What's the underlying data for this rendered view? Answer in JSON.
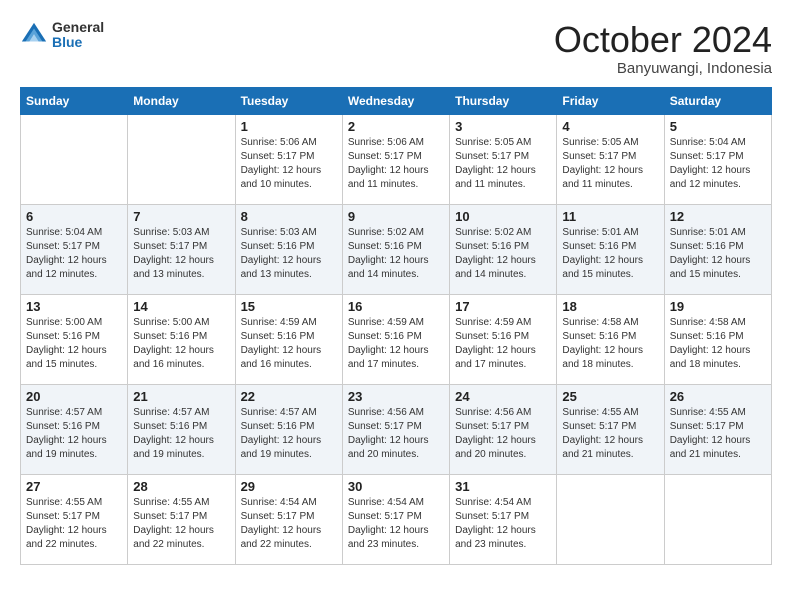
{
  "header": {
    "logo": {
      "general": "General",
      "blue": "Blue"
    },
    "title": "October 2024",
    "location": "Banyuwangi, Indonesia"
  },
  "columns": [
    "Sunday",
    "Monday",
    "Tuesday",
    "Wednesday",
    "Thursday",
    "Friday",
    "Saturday"
  ],
  "weeks": [
    [
      {
        "day": "",
        "sunrise": "",
        "sunset": "",
        "daylight": ""
      },
      {
        "day": "",
        "sunrise": "",
        "sunset": "",
        "daylight": ""
      },
      {
        "day": "1",
        "sunrise": "Sunrise: 5:06 AM",
        "sunset": "Sunset: 5:17 PM",
        "daylight": "Daylight: 12 hours and 10 minutes."
      },
      {
        "day": "2",
        "sunrise": "Sunrise: 5:06 AM",
        "sunset": "Sunset: 5:17 PM",
        "daylight": "Daylight: 12 hours and 11 minutes."
      },
      {
        "day": "3",
        "sunrise": "Sunrise: 5:05 AM",
        "sunset": "Sunset: 5:17 PM",
        "daylight": "Daylight: 12 hours and 11 minutes."
      },
      {
        "day": "4",
        "sunrise": "Sunrise: 5:05 AM",
        "sunset": "Sunset: 5:17 PM",
        "daylight": "Daylight: 12 hours and 11 minutes."
      },
      {
        "day": "5",
        "sunrise": "Sunrise: 5:04 AM",
        "sunset": "Sunset: 5:17 PM",
        "daylight": "Daylight: 12 hours and 12 minutes."
      }
    ],
    [
      {
        "day": "6",
        "sunrise": "Sunrise: 5:04 AM",
        "sunset": "Sunset: 5:17 PM",
        "daylight": "Daylight: 12 hours and 12 minutes."
      },
      {
        "day": "7",
        "sunrise": "Sunrise: 5:03 AM",
        "sunset": "Sunset: 5:17 PM",
        "daylight": "Daylight: 12 hours and 13 minutes."
      },
      {
        "day": "8",
        "sunrise": "Sunrise: 5:03 AM",
        "sunset": "Sunset: 5:16 PM",
        "daylight": "Daylight: 12 hours and 13 minutes."
      },
      {
        "day": "9",
        "sunrise": "Sunrise: 5:02 AM",
        "sunset": "Sunset: 5:16 PM",
        "daylight": "Daylight: 12 hours and 14 minutes."
      },
      {
        "day": "10",
        "sunrise": "Sunrise: 5:02 AM",
        "sunset": "Sunset: 5:16 PM",
        "daylight": "Daylight: 12 hours and 14 minutes."
      },
      {
        "day": "11",
        "sunrise": "Sunrise: 5:01 AM",
        "sunset": "Sunset: 5:16 PM",
        "daylight": "Daylight: 12 hours and 15 minutes."
      },
      {
        "day": "12",
        "sunrise": "Sunrise: 5:01 AM",
        "sunset": "Sunset: 5:16 PM",
        "daylight": "Daylight: 12 hours and 15 minutes."
      }
    ],
    [
      {
        "day": "13",
        "sunrise": "Sunrise: 5:00 AM",
        "sunset": "Sunset: 5:16 PM",
        "daylight": "Daylight: 12 hours and 15 minutes."
      },
      {
        "day": "14",
        "sunrise": "Sunrise: 5:00 AM",
        "sunset": "Sunset: 5:16 PM",
        "daylight": "Daylight: 12 hours and 16 minutes."
      },
      {
        "day": "15",
        "sunrise": "Sunrise: 4:59 AM",
        "sunset": "Sunset: 5:16 PM",
        "daylight": "Daylight: 12 hours and 16 minutes."
      },
      {
        "day": "16",
        "sunrise": "Sunrise: 4:59 AM",
        "sunset": "Sunset: 5:16 PM",
        "daylight": "Daylight: 12 hours and 17 minutes."
      },
      {
        "day": "17",
        "sunrise": "Sunrise: 4:59 AM",
        "sunset": "Sunset: 5:16 PM",
        "daylight": "Daylight: 12 hours and 17 minutes."
      },
      {
        "day": "18",
        "sunrise": "Sunrise: 4:58 AM",
        "sunset": "Sunset: 5:16 PM",
        "daylight": "Daylight: 12 hours and 18 minutes."
      },
      {
        "day": "19",
        "sunrise": "Sunrise: 4:58 AM",
        "sunset": "Sunset: 5:16 PM",
        "daylight": "Daylight: 12 hours and 18 minutes."
      }
    ],
    [
      {
        "day": "20",
        "sunrise": "Sunrise: 4:57 AM",
        "sunset": "Sunset: 5:16 PM",
        "daylight": "Daylight: 12 hours and 19 minutes."
      },
      {
        "day": "21",
        "sunrise": "Sunrise: 4:57 AM",
        "sunset": "Sunset: 5:16 PM",
        "daylight": "Daylight: 12 hours and 19 minutes."
      },
      {
        "day": "22",
        "sunrise": "Sunrise: 4:57 AM",
        "sunset": "Sunset: 5:16 PM",
        "daylight": "Daylight: 12 hours and 19 minutes."
      },
      {
        "day": "23",
        "sunrise": "Sunrise: 4:56 AM",
        "sunset": "Sunset: 5:17 PM",
        "daylight": "Daylight: 12 hours and 20 minutes."
      },
      {
        "day": "24",
        "sunrise": "Sunrise: 4:56 AM",
        "sunset": "Sunset: 5:17 PM",
        "daylight": "Daylight: 12 hours and 20 minutes."
      },
      {
        "day": "25",
        "sunrise": "Sunrise: 4:55 AM",
        "sunset": "Sunset: 5:17 PM",
        "daylight": "Daylight: 12 hours and 21 minutes."
      },
      {
        "day": "26",
        "sunrise": "Sunrise: 4:55 AM",
        "sunset": "Sunset: 5:17 PM",
        "daylight": "Daylight: 12 hours and 21 minutes."
      }
    ],
    [
      {
        "day": "27",
        "sunrise": "Sunrise: 4:55 AM",
        "sunset": "Sunset: 5:17 PM",
        "daylight": "Daylight: 12 hours and 22 minutes."
      },
      {
        "day": "28",
        "sunrise": "Sunrise: 4:55 AM",
        "sunset": "Sunset: 5:17 PM",
        "daylight": "Daylight: 12 hours and 22 minutes."
      },
      {
        "day": "29",
        "sunrise": "Sunrise: 4:54 AM",
        "sunset": "Sunset: 5:17 PM",
        "daylight": "Daylight: 12 hours and 22 minutes."
      },
      {
        "day": "30",
        "sunrise": "Sunrise: 4:54 AM",
        "sunset": "Sunset: 5:17 PM",
        "daylight": "Daylight: 12 hours and 23 minutes."
      },
      {
        "day": "31",
        "sunrise": "Sunrise: 4:54 AM",
        "sunset": "Sunset: 5:17 PM",
        "daylight": "Daylight: 12 hours and 23 minutes."
      },
      {
        "day": "",
        "sunrise": "",
        "sunset": "",
        "daylight": ""
      },
      {
        "day": "",
        "sunrise": "",
        "sunset": "",
        "daylight": ""
      }
    ]
  ]
}
